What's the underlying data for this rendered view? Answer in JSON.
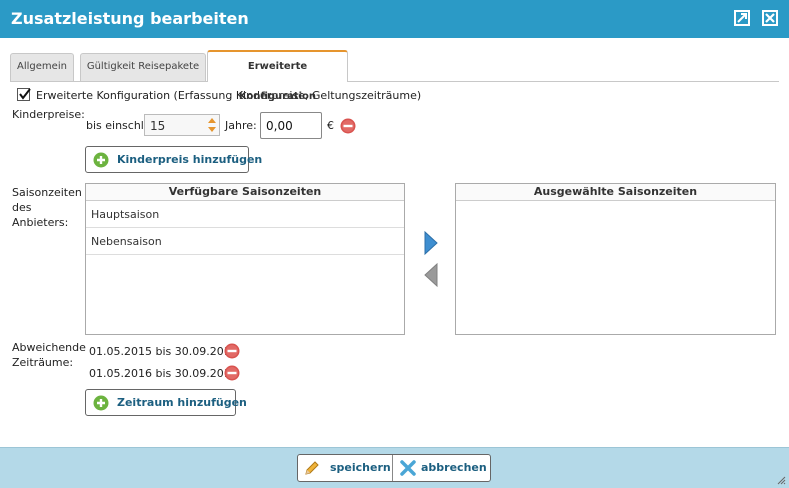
{
  "window": {
    "title": "Zusatzleistung bearbeiten"
  },
  "tabs": [
    {
      "label": "Allgemein"
    },
    {
      "label": "Gültigkeit Reisepakete"
    },
    {
      "label": "Erweiterte Konfiguration"
    }
  ],
  "config": {
    "checkbox_label": "Erweiterte Konfiguration (Erfassung Kinderpreise, Geltungszeiträume)",
    "checked": true
  },
  "kinderpreise": {
    "label": "Kinderpreise:",
    "up_to_label": "bis einschl.",
    "age_value": "15",
    "years_label": "Jahre:",
    "price_value": "0,00",
    "currency": "€",
    "add_button": "Kinderpreis hinzufügen"
  },
  "saison": {
    "label_lines": [
      "Saisonzeiten",
      "des",
      "Anbieters:"
    ],
    "available_header": "Verfügbare Saisonzeiten",
    "available_items": [
      "Hauptsaison",
      "Nebensaison"
    ],
    "selected_header": "Ausgewählte Saisonzeiten",
    "selected_items": []
  },
  "zeitraeume": {
    "label_lines": [
      "Abweichende",
      "Zeiträume:"
    ],
    "items": [
      "01.05.2015 bis 30.09.2015",
      "01.05.2016 bis 30.09.2016"
    ],
    "add_button": "Zeitraum hinzufügen"
  },
  "footer": {
    "save_label": "speichern",
    "cancel_label": "abbrechen"
  },
  "colors": {
    "titlebar": "#2b9ac6",
    "footer": "#b4d9e8",
    "accent_tab": "#e6952e",
    "link_text": "#1c5f80",
    "remove_red": "#d9534f",
    "add_green": "#6cb33f"
  }
}
